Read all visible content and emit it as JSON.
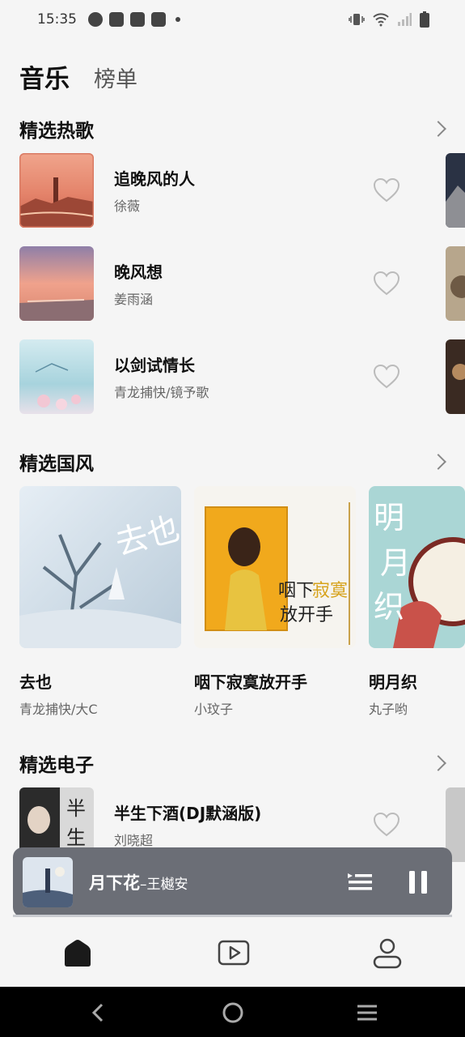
{
  "status_bar": {
    "time": "15:35"
  },
  "header": {
    "tab_active": "音乐",
    "tab_inactive": "榜单"
  },
  "hot_songs": {
    "title": "精选热歌",
    "items": [
      {
        "title": "追晚风的人",
        "artist": "徐薇"
      },
      {
        "title": "晚风想",
        "artist": "姜雨涵"
      },
      {
        "title": "以剑试情长",
        "artist": "青龙捕快/镜予歌"
      }
    ]
  },
  "guofeng": {
    "title": "精选国风",
    "cards": [
      {
        "title": "去也",
        "artist": "青龙捕快/大C"
      },
      {
        "title": "咽下寂寞放开手",
        "artist": "小玟子"
      },
      {
        "title": "明月织",
        "artist": "丸子哟"
      }
    ]
  },
  "electronic": {
    "title": "精选电子",
    "items": [
      {
        "title": "半生下酒(DJ默涵版)",
        "artist": "刘晓超"
      }
    ]
  },
  "mini_player": {
    "title": "月下花",
    "artist": "–王樾安"
  },
  "colors": {
    "player_bg": "#6b6e76",
    "page_bg": "#f5f5f5"
  }
}
